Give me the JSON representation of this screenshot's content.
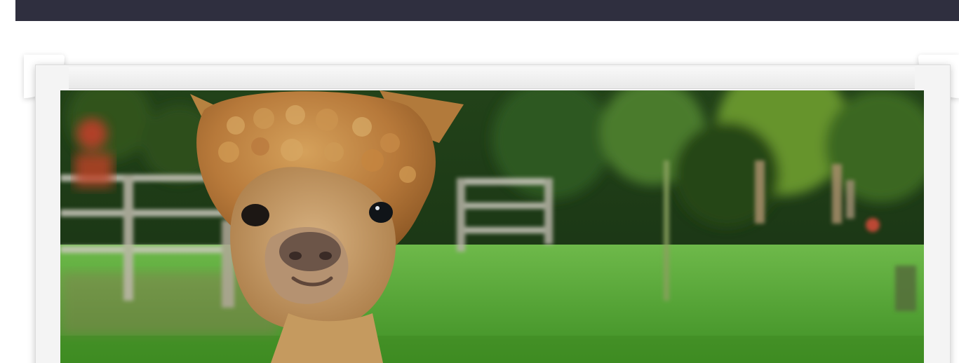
{
  "header": {
    "background_color": "#2f2f3f"
  },
  "hero": {
    "image_subject": "alpaca",
    "frame_color": "#f4f4f4"
  }
}
